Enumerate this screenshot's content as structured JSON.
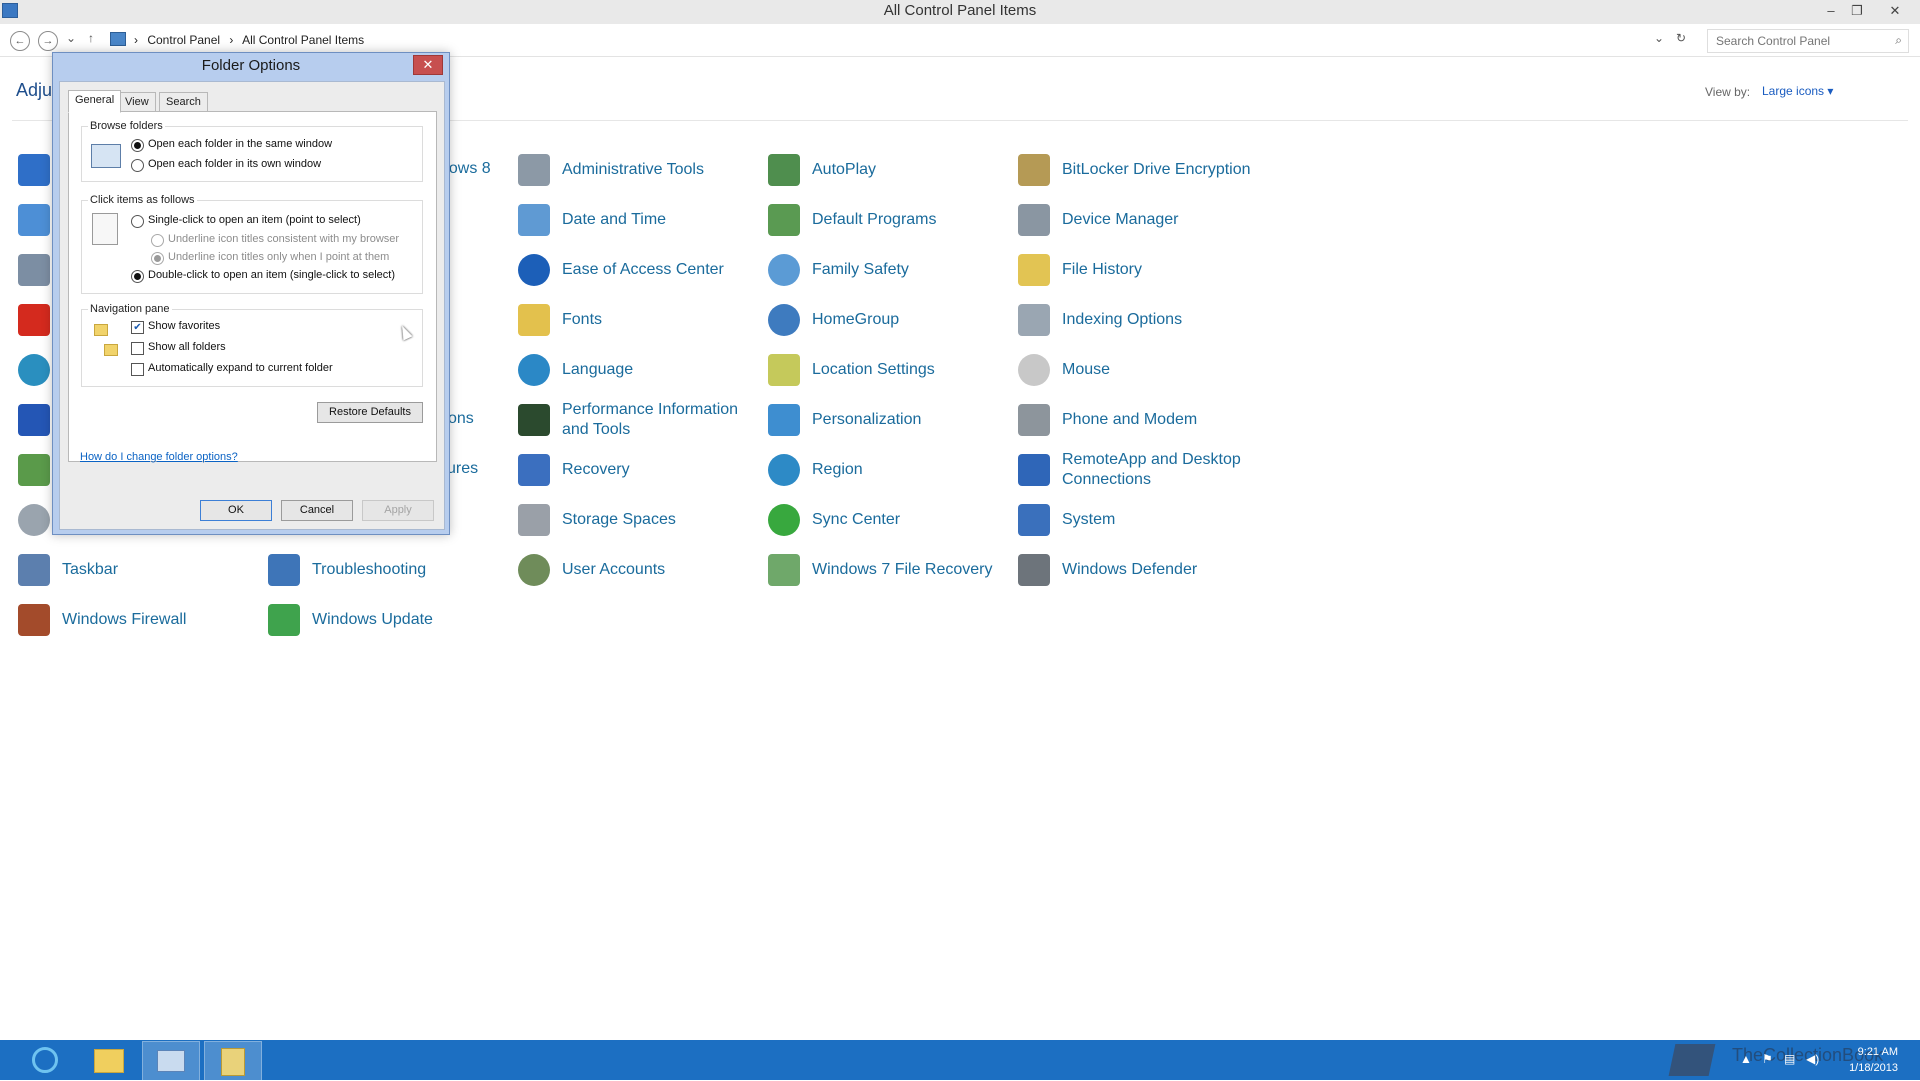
{
  "window": {
    "title": "All Control Panel Items",
    "minimize": "–",
    "restore": "❐",
    "close": "✕"
  },
  "address": {
    "back": "←",
    "forward": "→",
    "recent": "⌄",
    "up": "↑",
    "crumbs": [
      "Control Panel",
      "All Control Panel Items"
    ],
    "sep": "›",
    "dropdown": "⌄",
    "refresh": "↻",
    "search_placeholder": "Search Control Panel",
    "search_icon": "⌕"
  },
  "header": {
    "adjust_partial": "Adju",
    "view_by_label": "View by:",
    "view_by_value": "Large icons ▾"
  },
  "items": {
    "c2_r1": "dows 8",
    "c2_r6": "ons",
    "c2_r7": "ures",
    "c1_r9": "Taskbar",
    "c1_r10": "Windows Firewall",
    "c2_r9": "Troubleshooting",
    "c2_r10": "Windows Update",
    "c3": [
      "Administrative Tools",
      "Date and Time",
      "Ease of Access Center",
      "Fonts",
      "Language",
      "Performance Information and Tools",
      "Recovery",
      "Storage Spaces",
      "User Accounts"
    ],
    "c4": [
      "AutoPlay",
      "Default Programs",
      "Family Safety",
      "HomeGroup",
      "Location Settings",
      "Personalization",
      "Region",
      "Sync Center",
      "Windows 7 File Recovery"
    ],
    "c5": [
      "BitLocker Drive Encryption",
      "Device Manager",
      "File History",
      "Indexing Options",
      "Mouse",
      "Phone and Modem",
      "RemoteApp and Desktop Connections",
      "System",
      "Windows Defender"
    ]
  },
  "dialog": {
    "title": "Folder Options",
    "close": "✕",
    "tabs": [
      "General",
      "View",
      "Search"
    ],
    "browse_title": "Browse folders",
    "browse_opt1": "Open each folder in the same window",
    "browse_opt2": "Open each folder in its own window",
    "click_title": "Click items as follows",
    "click_opt1": "Single-click to open an item (point to select)",
    "click_sub1": "Underline icon titles consistent with my browser",
    "click_sub2": "Underline icon titles only when I point at them",
    "click_opt2": "Double-click to open an item (single-click to select)",
    "nav_title": "Navigation pane",
    "nav_opt1": "Show favorites",
    "nav_opt2": "Show all folders",
    "nav_opt3": "Automatically expand to current folder",
    "check_mark": "✔",
    "restore": "Restore Defaults",
    "help_link": "How do I change folder options?",
    "ok": "OK",
    "cancel": "Cancel",
    "apply": "Apply"
  },
  "taskbar": {
    "time": "9:21 AM",
    "date": "1/18/2013",
    "watermark": "TheCollectionBook",
    "tray_up": "▲",
    "tray_flag": "⚑",
    "tray_net": "▤",
    "tray_vol": "◀)"
  },
  "colors": {
    "link": "#1a6b9c",
    "taskbar": "#1c6fc2",
    "dialog_frame": "#b7cdee"
  }
}
